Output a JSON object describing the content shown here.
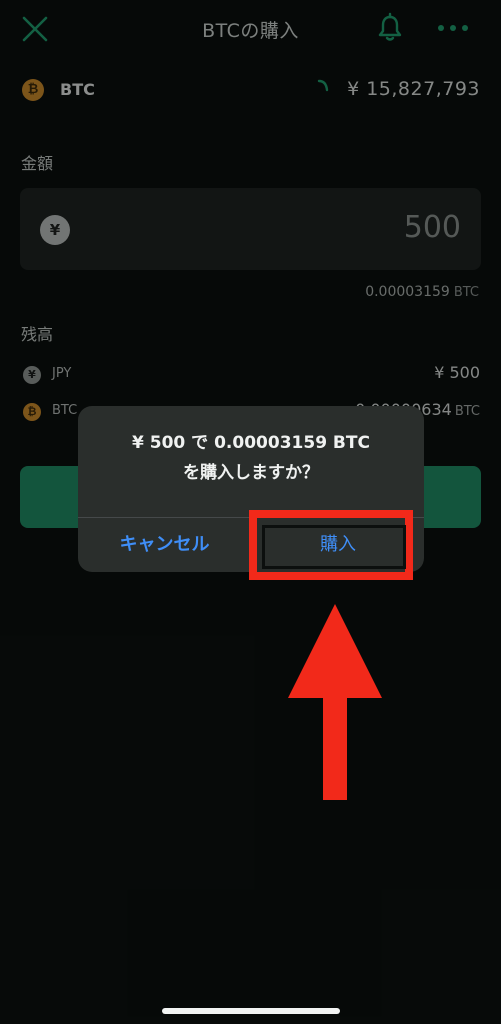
{
  "header": {
    "title": "BTCの購入",
    "close_icon": "close-icon",
    "bell_icon": "bell-icon",
    "more_icon": "more-icon"
  },
  "coin": {
    "symbol_glyph": "₿",
    "name": "BTC",
    "price": "¥ 15,827,793"
  },
  "amount": {
    "label": "金額",
    "currency_glyph": "¥",
    "value": "500",
    "conversion_value": "0.00003159",
    "conversion_unit": "BTC"
  },
  "balance": {
    "label": "残高",
    "jpy": {
      "glyph": "¥",
      "name": "JPY",
      "value": "¥ 500"
    },
    "btc": {
      "glyph": "₿",
      "name": "BTC",
      "value": "0.00000634",
      "unit": "BTC"
    }
  },
  "alert": {
    "line1": "¥ 500 で 0.00003159 BTC",
    "line2": "を購入しますか？",
    "cancel_label": "キャンセル",
    "confirm_label": "購入"
  },
  "colors": {
    "accent_green": "#1f8a63",
    "link_blue": "#3f8ef7",
    "highlight_red": "#f2291a",
    "btc_orange": "#c9892a"
  }
}
